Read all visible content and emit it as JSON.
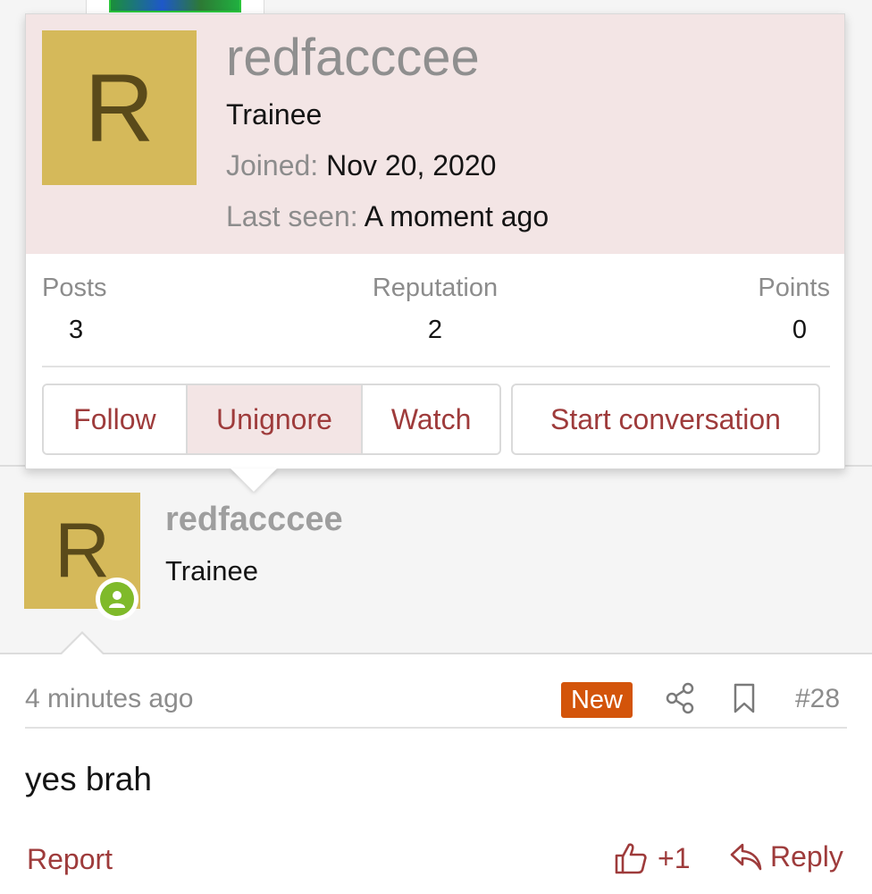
{
  "member_card": {
    "avatar_letter": "R",
    "username": "redfacccee",
    "user_title": "Trainee",
    "joined_label": "Joined:",
    "joined_value": "Nov 20, 2020",
    "last_seen_label": "Last seen:",
    "last_seen_value": "A moment ago",
    "stats": [
      {
        "label": "Posts",
        "value": "3"
      },
      {
        "label": "Reputation",
        "value": "2"
      },
      {
        "label": "Points",
        "value": "0"
      }
    ],
    "buttons": {
      "follow": "Follow",
      "unignore": "Unignore",
      "watch": "Watch",
      "start_conversation": "Start conversation"
    }
  },
  "message": {
    "user": {
      "avatar_letter": "R",
      "username": "redfacccee",
      "user_title": "Trainee",
      "status_icon": "online-user-icon"
    },
    "time": "4 minutes ago",
    "new_badge": "New",
    "post_number": "#28",
    "text": "yes brah",
    "actions": {
      "report": "Report",
      "like": "+1",
      "reply": "Reply"
    },
    "icons": [
      "share-icon",
      "bookmark-icon",
      "thumbs-up-icon",
      "reply-icon"
    ]
  },
  "colors": {
    "accent": "#9e3b3b",
    "card_header_bg": "#f3e5e5",
    "avatar_bg": "#d5b95a",
    "avatar_fg": "#5a4a1a",
    "new_badge_bg": "#d3540a",
    "online": "#7fba2a",
    "muted_text": "#8c8c8c"
  }
}
